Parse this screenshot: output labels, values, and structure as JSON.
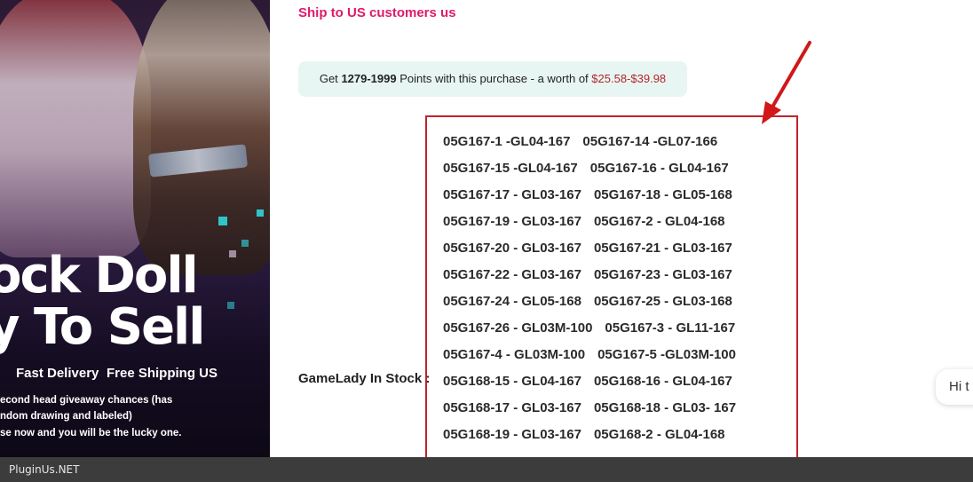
{
  "banner": {
    "headline_line1": "ock Doll",
    "headline_line2": "y To Sell",
    "feature_fast": "Fast Delivery",
    "feature_free": "Free Shipping US",
    "fine_print_1": "econd head giveaway chances (has",
    "fine_print_2": "ndom drawing and labeled)",
    "fine_print_3": "se now and you will be the lucky one."
  },
  "shipping": {
    "link_text": "Ship to US customers us"
  },
  "points": {
    "prefix": "Get",
    "range": "1279-1999",
    "middle": "Points with this purchase - a worth of",
    "money": "$25.58-$39.98"
  },
  "stock": {
    "label": "GameLady In Stock :",
    "rows": [
      [
        "05G167-1 -GL04-167",
        "05G167-14 -GL07-166"
      ],
      [
        "05G167-15 -GL04-167",
        "05G167-16 - GL04-167"
      ],
      [
        "05G167-17 - GL03-167",
        "05G167-18 - GL05-168"
      ],
      [
        "05G167-19 - GL03-167",
        "05G167-2 - GL04-168"
      ],
      [
        "05G167-20 - GL03-167",
        "05G167-21 - GL03-167"
      ],
      [
        "05G167-22 - GL03-167",
        "05G167-23 - GL03-167"
      ],
      [
        "05G167-24 - GL05-168",
        "05G167-25 - GL03-168"
      ],
      [
        "05G167-26 - GL03M-100",
        "05G167-3 - GL11-167"
      ],
      [
        "05G167-4 - GL03M-100",
        "05G167-5 -GL03M-100"
      ],
      [
        "05G168-15 - GL04-167",
        "05G168-16 - GL04-167"
      ],
      [
        "05G168-17 - GL03-167",
        "05G168-18 - GL03- 167"
      ],
      [
        "05G168-19 - GL03-167",
        "05G168-2 - GL04-168"
      ]
    ]
  },
  "chat": {
    "preview": "Hi t"
  },
  "footer": {
    "text": "PluginUs.NET"
  },
  "colors": {
    "accent_pink": "#e0196b",
    "highlight_red": "#c0242b",
    "points_bg": "#e8f6f3",
    "money_red": "#b3262a"
  },
  "icons": {
    "annotation": "red-arrow-icon"
  }
}
